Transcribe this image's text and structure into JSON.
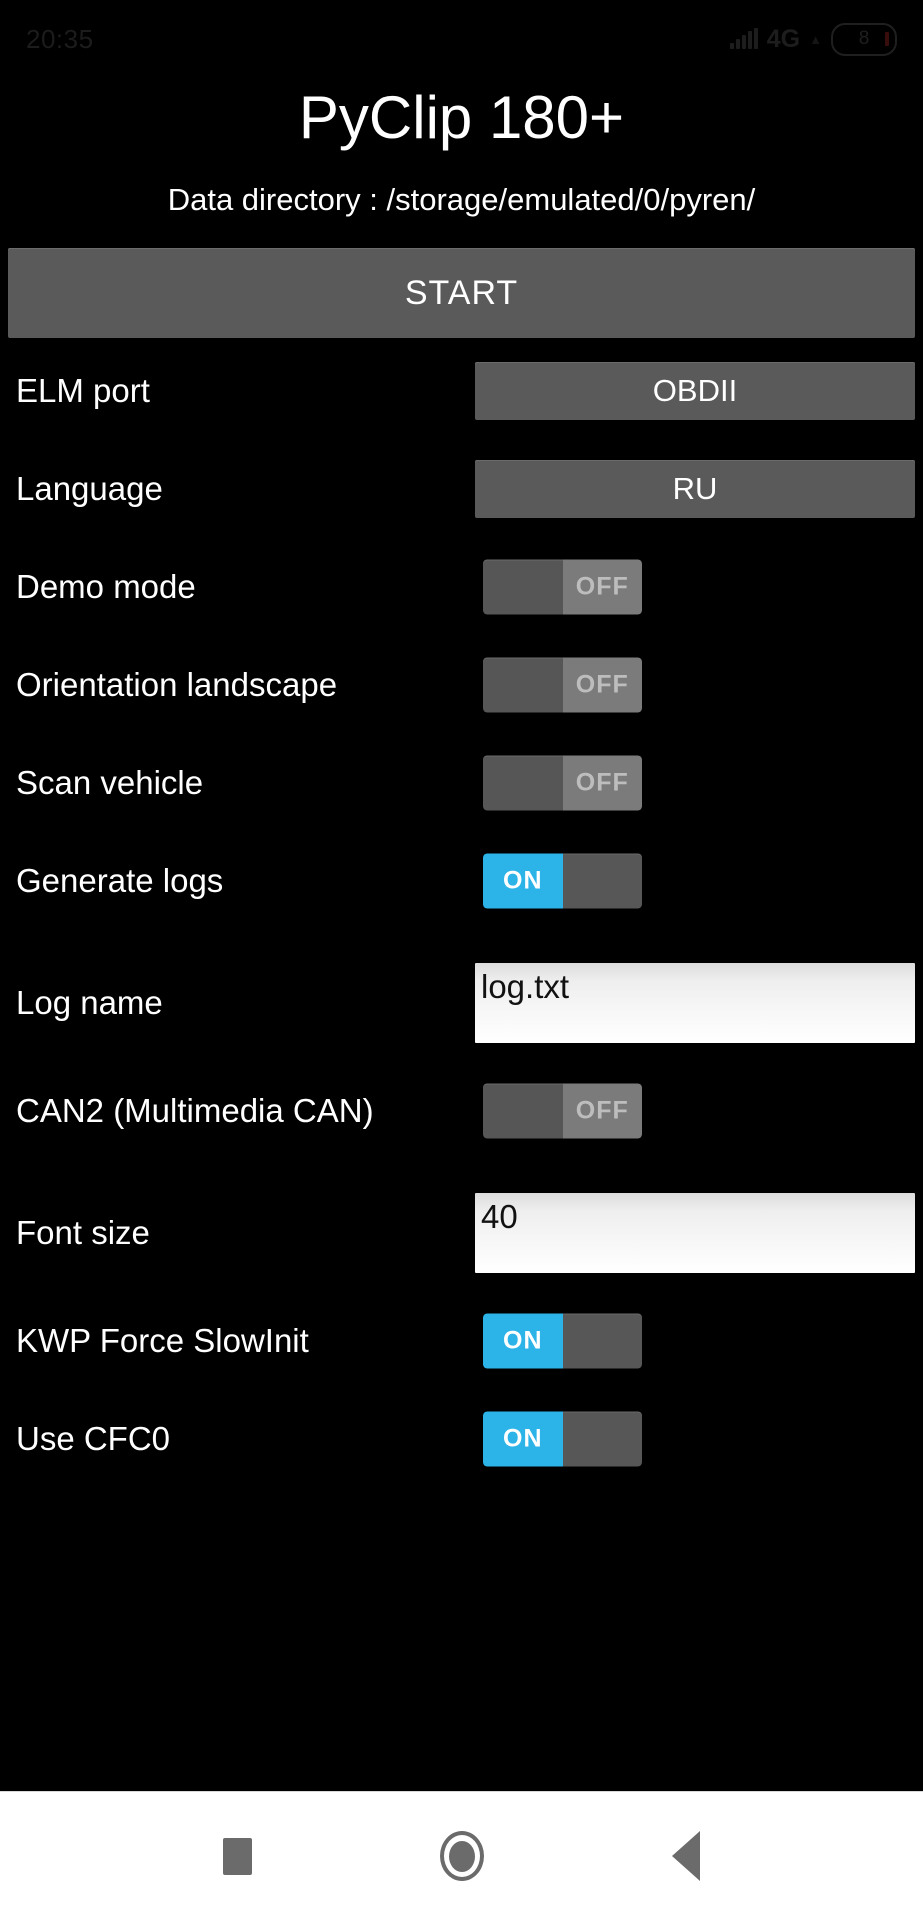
{
  "status_bar": {
    "time": "20:35",
    "network": "4G",
    "battery_level": "8",
    "signal_icon": "signal-bars-icon",
    "wifi_icon": "wifi-small-icon",
    "battery_icon": "battery-icon"
  },
  "app": {
    "title": "PyClip 180+",
    "subtitle": "Data directory : /storage/emulated/0/pyren/",
    "start_label": "START"
  },
  "settings": [
    {
      "label": "ELM port",
      "type": "select",
      "value": "OBDII"
    },
    {
      "label": "Language",
      "type": "select",
      "value": "RU"
    },
    {
      "label": "Demo mode",
      "type": "toggle",
      "value": "OFF"
    },
    {
      "label": "Orientation landscape",
      "type": "toggle",
      "value": "OFF"
    },
    {
      "label": "Scan vehicle",
      "type": "toggle",
      "value": "OFF"
    },
    {
      "label": "Generate logs",
      "type": "toggle",
      "value": "ON"
    },
    {
      "label": "Log name",
      "type": "input",
      "value": "log.txt"
    },
    {
      "label": "CAN2 (Multimedia CAN)",
      "type": "toggle",
      "value": "OFF"
    },
    {
      "label": "Font size",
      "type": "input",
      "value": "40"
    },
    {
      "label": "KWP Force SlowInit",
      "type": "toggle",
      "value": "ON"
    },
    {
      "label": "Use CFC0",
      "type": "toggle",
      "value": "ON"
    }
  ],
  "nav_bar": {
    "recents_icon": "square-recents-icon",
    "home_icon": "circle-home-icon",
    "back_icon": "triangle-back-icon"
  },
  "colors": {
    "background": "#000000",
    "button": "#5a5a5a",
    "toggle_on": "#2cb3e8",
    "toggle_off_track": "#7b7b7b",
    "input_background": "#f4f4f4",
    "nav_bar": "#ffffff"
  }
}
